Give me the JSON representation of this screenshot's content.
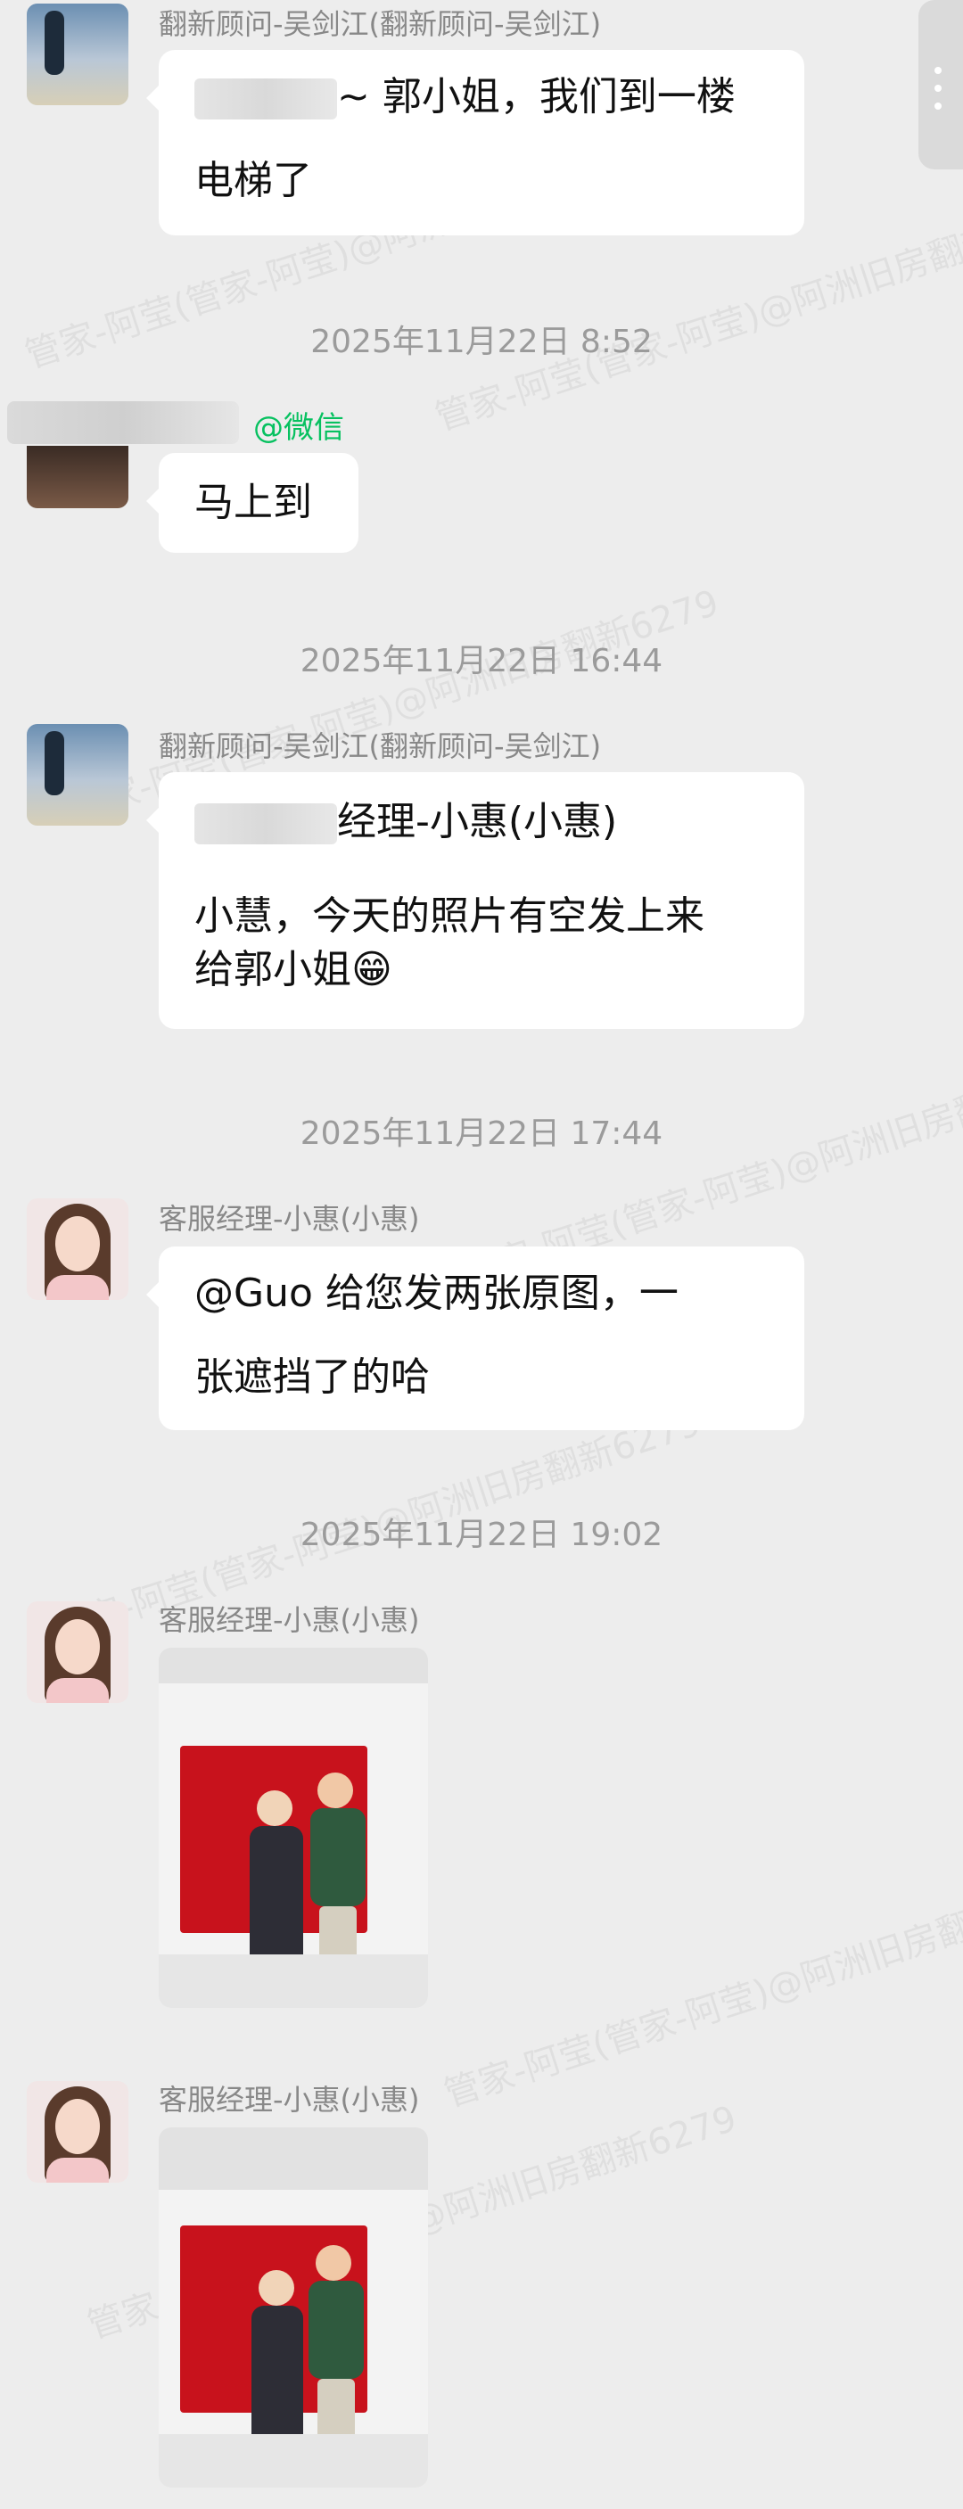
{
  "watermark": "管家-阿莹(管家-阿莹)@阿洲旧房翻新6279",
  "messages": [
    {
      "sender": "翻新顾问-吴剑江(翻新顾问-吴剑江)",
      "lines": [
        "~ 郭小姐，我们到一楼",
        "电梯了"
      ]
    },
    {
      "time": "2025年11月22日 8:52"
    },
    {
      "tag": "@微信",
      "lines": [
        "马上到"
      ]
    },
    {
      "time": "2025年11月22日 16:44"
    },
    {
      "sender": "翻新顾问-吴剑江(翻新顾问-吴剑江)",
      "lines": [
        "经理-小惠(小惠)",
        "",
        "小慧，今天的照片有空发上来",
        "给郭小姐"
      ],
      "emoji": "😁"
    },
    {
      "time": "2025年11月22日 17:44"
    },
    {
      "sender": "客服经理-小惠(小惠)",
      "lines": [
        "@Guo  给您发两张原图，一",
        "张遮挡了的哈"
      ]
    },
    {
      "time": "2025年11月22日 19:02"
    },
    {
      "sender": "客服经理-小惠(小惠)",
      "photo": "photo-1"
    },
    {
      "sender": "客服经理-小惠(小惠)",
      "photo": "photo-2"
    }
  ],
  "colors": {
    "bg": "#ededed",
    "bubble": "#ffffff",
    "accent": "#07c160",
    "timestamp": "#9b9b9b"
  }
}
